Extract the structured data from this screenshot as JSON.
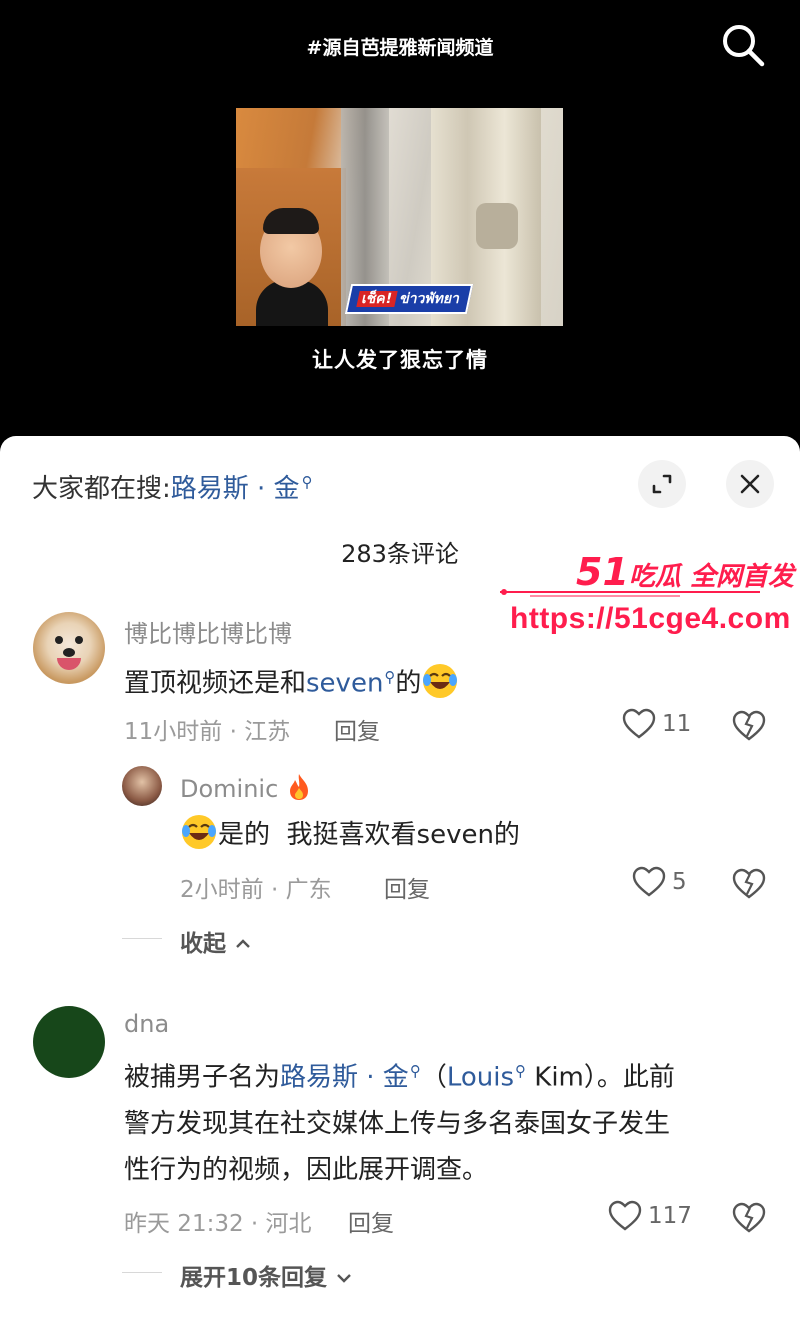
{
  "video": {
    "channel_tag": "#源自芭提雅新闻频道",
    "badge_part1": "เช็ค!",
    "badge_part2": "ข่าวพัทยา",
    "subtitle": "让人发了狠忘了情"
  },
  "sheet": {
    "search_hint_prefix": "大家都在搜:",
    "search_hint_keyword": "路易斯 · 金",
    "comment_count": "283条评论"
  },
  "watermark": {
    "title_number": "51",
    "title_text": "吃瓜 全网首发",
    "url": "https://51cge4.com"
  },
  "comments": [
    {
      "author": "博比博比博比博",
      "text_before": "置顶视频还是和",
      "keyword": "seven",
      "text_after": "的",
      "time_location": "11小时前 · 江苏",
      "reply_label": "回复",
      "likes": "11"
    },
    {
      "author": "Dominic",
      "text": "是的  我挺喜欢看seven的",
      "time_location": "2小时前 · 广东",
      "reply_label": "回复",
      "likes": "5",
      "collapse_label": "收起"
    },
    {
      "author": "dna",
      "line1_before": "被捕男子名为",
      "line1_keyword": "路易斯 · 金",
      "line1_paren_open": "（",
      "line1_keyword2": "Louis",
      "line1_after": " Kim）。此前",
      "line2": "警方发现其在社交媒体上传与多名泰国女子发生",
      "line3": "性行为的视频，因此展开调查。",
      "time_location": "昨天 21:32 · 河北",
      "reply_label": "回复",
      "likes": "117",
      "expand_label": "展开10条回复"
    }
  ]
}
